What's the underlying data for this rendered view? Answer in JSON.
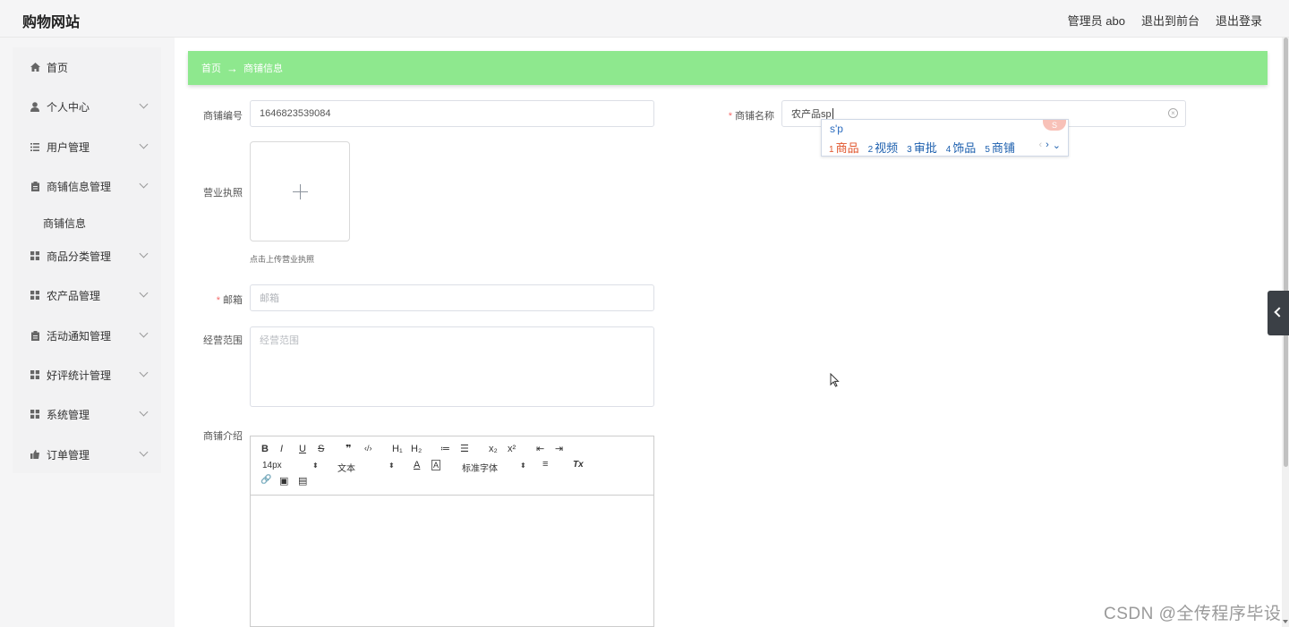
{
  "header": {
    "brand": "购物网站",
    "user": "管理员 abo",
    "to_front": "退出到前台",
    "logout": "退出登录"
  },
  "sidebar": {
    "items": [
      {
        "label": "首页",
        "icon": "home-icon"
      },
      {
        "label": "个人中心",
        "icon": "user-icon"
      },
      {
        "label": "用户管理",
        "icon": "list-icon"
      },
      {
        "label": "商铺信息管理",
        "icon": "clipboard-icon"
      },
      {
        "label": "商品分类管理",
        "icon": "grid-icon"
      },
      {
        "label": "农产品管理",
        "icon": "grid-icon"
      },
      {
        "label": "活动通知管理",
        "icon": "clipboard-icon"
      },
      {
        "label": "好评统计管理",
        "icon": "grid-icon"
      },
      {
        "label": "系统管理",
        "icon": "grid-icon"
      },
      {
        "label": "订单管理",
        "icon": "thumbs-up-icon"
      }
    ],
    "sub_item": "商铺信息"
  },
  "breadcrumb": {
    "home": "首页",
    "sep": "→",
    "current": "商铺信息"
  },
  "form": {
    "shop_no_label": "商铺编号",
    "shop_no_value": "1646823539084",
    "shop_name_label": "商铺名称",
    "shop_name_value": "农产品sp",
    "license_label": "营业执照",
    "upload_tip": "点击上传营业执照",
    "email_label": "邮箱",
    "email_placeholder": "邮箱",
    "scope_label": "经营范围",
    "scope_placeholder": "经营范围",
    "intro_label": "商铺介绍",
    "required_mark": "*"
  },
  "ime": {
    "pinyin": "s'p",
    "candidates": [
      {
        "n": "1",
        "text": "商品"
      },
      {
        "n": "2",
        "text": "视频"
      },
      {
        "n": "3",
        "text": "审批"
      },
      {
        "n": "4",
        "text": "饰品"
      },
      {
        "n": "5",
        "text": "商铺"
      }
    ],
    "logo": "S"
  },
  "editor": {
    "font_size": "14px",
    "block_type": "文本",
    "font_family": "标准字体",
    "buttons": {
      "bold": "B",
      "italic": "I",
      "underline": "U",
      "strike": "S",
      "quote": "❞",
      "code": "‹/›",
      "h1": "H₁",
      "h2": "H₂",
      "ol": "≔",
      "ul": "☰",
      "sub": "x₂",
      "sup": "x²",
      "outdent": "⇤",
      "indent": "⇥",
      "color": "A",
      "bg": "A",
      "align": "≡",
      "clear": "Tx",
      "link": "🔗",
      "image": "▣",
      "video": "▤"
    }
  },
  "watermark": "CSDN @全传程序毕设"
}
